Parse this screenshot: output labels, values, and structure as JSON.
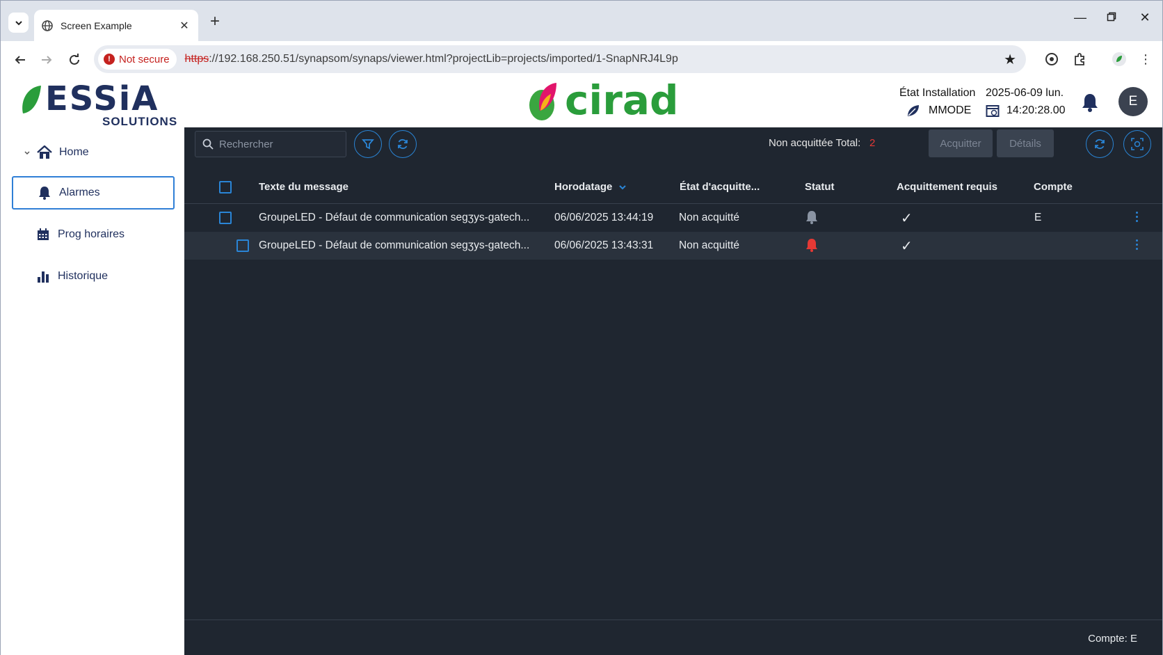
{
  "browser": {
    "tab_title": "Screen Example",
    "security_label": "Not secure",
    "url_scheme": "https",
    "url_rest": "://192.168.250.51/synapsom/synaps/viewer.html?projectLib=projects/imported/1-SnapNRJ4L9p"
  },
  "header": {
    "logo_left": "ESSiA",
    "logo_left_sub": "SOLUTIONS",
    "logo_center": "cirad",
    "install_label": "État Installation",
    "mode": "MMODE",
    "date": "2025-06-09 lun.",
    "time": "14:20:28.00",
    "avatar": "E"
  },
  "sidebar": {
    "items": [
      {
        "label": "Home"
      },
      {
        "label": "Alarmes"
      },
      {
        "label": "Prog horaires"
      },
      {
        "label": "Historique"
      }
    ]
  },
  "toolbar": {
    "search_placeholder": "Rechercher",
    "total_label": "Non acquittée Total:",
    "total_count": "2",
    "ack_label": "Acquitter",
    "details_label": "Détails"
  },
  "table": {
    "columns": [
      "Texte du message",
      "Horodatage",
      "État d'acquitte...",
      "Statut",
      "Acquittement requis",
      "Compte"
    ],
    "rows": [
      {
        "message": "GroupeLED - Défaut de communication segʒys-gatech...",
        "timestamp": "06/06/2025 13:44:19",
        "ack_state": "Non acquitté",
        "status": "inactive",
        "ack_required": "✓",
        "account": "E"
      },
      {
        "message": "GroupeLED - Défaut de communication segʒys-gatech...",
        "timestamp": "06/06/2025 13:43:31",
        "ack_state": "Non acquitté",
        "status": "active",
        "ack_required": "✓",
        "account": ""
      }
    ]
  },
  "footer": {
    "account_label": "Compte: E"
  },
  "colors": {
    "accent": "#2a85d6",
    "alarm_active": "#e53935",
    "alarm_inactive": "#8a94a3",
    "panel_bg": "#1f2630",
    "brand_navy": "#20305e",
    "brand_green": "#2a9d3b"
  }
}
